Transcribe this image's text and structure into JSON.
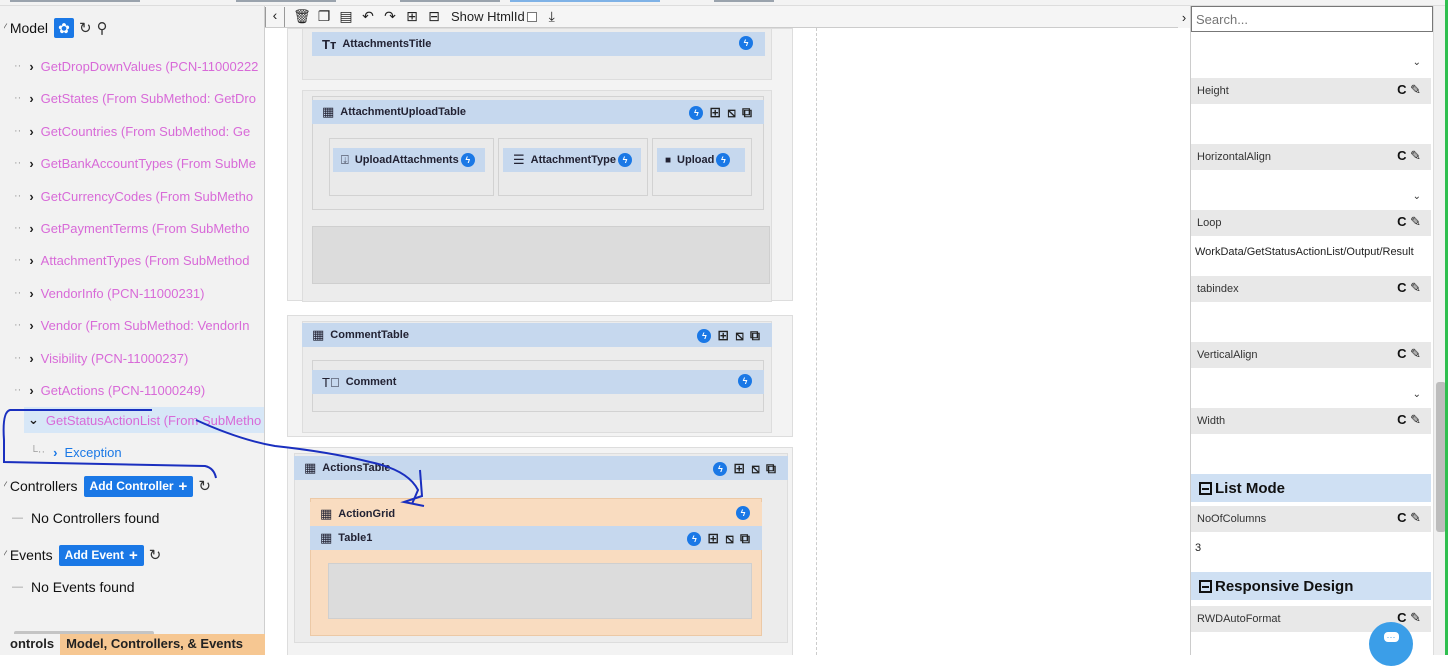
{
  "left": {
    "model_label": "Model",
    "model_items": [
      "GetDropDownValues (PCN-11000222",
      "GetStates (From SubMethod: GetDro",
      "GetCountries (From SubMethod: Ge",
      "GetBankAccountTypes (From SubMe",
      "GetCurrencyCodes (From SubMetho",
      "GetPaymentTerms (From SubMetho",
      "AttachmentTypes (From SubMethod",
      "VendorInfo (PCN-11000231)",
      "Vendor (From SubMethod: VendorIn",
      "Visibility (PCN-11000237)",
      "GetActions (PCN-11000249)",
      "GetStatusActionList (From SubMetho"
    ],
    "child_item": "Exception",
    "controllers_label": "Controllers",
    "add_controller_label": "Add Controller",
    "no_controllers": "No Controllers found",
    "events_label": "Events",
    "add_event_label": "Add Event",
    "no_events": "No Events found",
    "bottom_tabs": [
      "ontrols",
      "Model, Controllers, & Events"
    ]
  },
  "toolbar": {
    "show_htmlid_label": "Show HtmlId"
  },
  "canvas": {
    "attachments_title": "AttachmentsTitle",
    "attachment_upload_table": "AttachmentUploadTable",
    "upload_attachments": "UploadAttachments",
    "attachment_type": "AttachmentType",
    "upload": "Upload",
    "comment_table": "CommentTable",
    "comment": "Comment",
    "actions_table": "ActionsTable",
    "action_grid": "ActionGrid",
    "table1": "Table1"
  },
  "right": {
    "search_placeholder": "Search...",
    "props": {
      "height": "Height",
      "horizontal_align": "HorizontalAlign",
      "loop": "Loop",
      "loop_value": "WorkData/GetStatusActionList/Output/Result",
      "tabindex": "tabindex",
      "vertical_align": "VerticalAlign",
      "width": "Width",
      "no_of_columns": "NoOfColumns",
      "no_of_columns_value": "3",
      "rwd_auto_format": "RWDAutoFormat"
    },
    "sections": {
      "list_mode": "List Mode",
      "responsive_design": "Responsive Design"
    }
  },
  "colors": {
    "accent": "#1a78e6",
    "model_item": "#d86ad8",
    "header_blue": "#c6d8ee",
    "grid_orange": "#f9dcc0",
    "annotation": "#1a2fbf"
  }
}
